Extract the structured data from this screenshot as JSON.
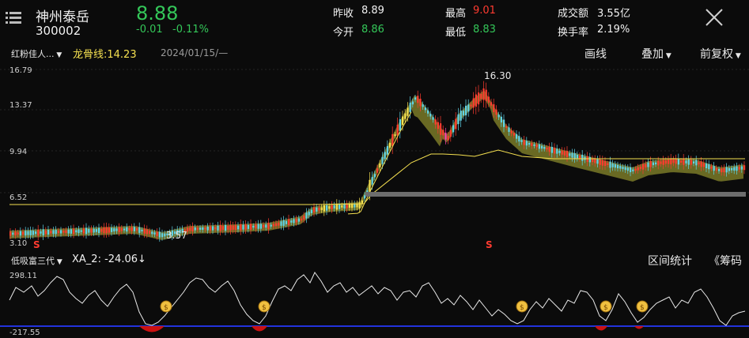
{
  "header": {
    "name": "神州泰岳",
    "code": "300002",
    "price": "8.88",
    "change": "-0.01",
    "change_pct": "-0.11%",
    "stats": {
      "prev_close_label": "昨收",
      "prev_close": "8.89",
      "open_label": "今开",
      "open": "8.86",
      "high_label": "最高",
      "high": "9.01",
      "low_label": "最低",
      "low": "8.83",
      "amount_label": "成交额",
      "amount": "3.55亿",
      "turnover_label": "换手率",
      "turnover": "2.19%"
    }
  },
  "toolbar": {
    "indicator_select": "红粉佳人...",
    "dragon_line": "龙骨线:14.23",
    "date": "2024/01/15/—",
    "draw_label": "画线",
    "overlay_label": "叠加",
    "adjust_label": "前复权"
  },
  "main_chart": {
    "y_labels": [
      "16.79",
      "13.37",
      "9.94",
      "6.52",
      "3.10"
    ],
    "max_annotation": "16.30",
    "min_annotation": "3.57",
    "s_marks": [
      "S",
      "S"
    ]
  },
  "sub_panel": {
    "indicator_select": "低吸富三代",
    "xa_label": "XA_2: -24.06↓",
    "interval_label": "区间统计",
    "chips_label": "《筹码",
    "y_top": "298.11",
    "y_bottom": "-217.55"
  },
  "colors": {
    "up": "#ff3b30",
    "down": "#34c759",
    "yellow": "#f5e050",
    "cyan": "#5fd3e8",
    "cloud": "#7a7a28",
    "blue_line": "#2233dd"
  }
}
